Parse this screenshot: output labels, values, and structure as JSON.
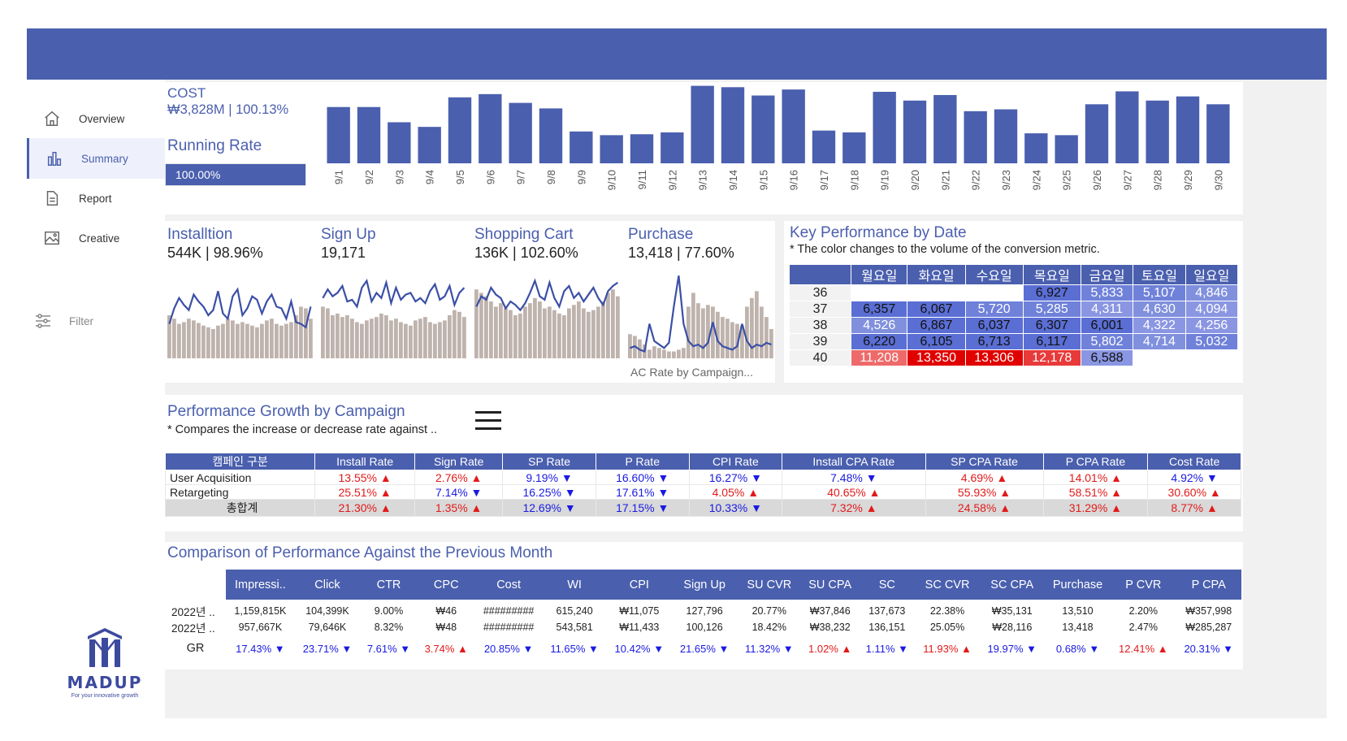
{
  "nav": {
    "items": [
      {
        "label": "Overview",
        "icon": "home-icon"
      },
      {
        "label": "Summary",
        "icon": "bar-chart-icon"
      },
      {
        "label": "Report",
        "icon": "document-icon"
      },
      {
        "label": "Creative",
        "icon": "image-icon"
      }
    ],
    "active": "Summary",
    "filter_label": "Filter"
  },
  "logo": {
    "word": "MADUP",
    "tagline": "For your innovative growth"
  },
  "cost": {
    "title": "COST",
    "value": "₩3,828M | 100.13%",
    "running_rate_label": "Running Rate",
    "running_rate_value": "100.00%",
    "running_rate": 1.0
  },
  "kpis": [
    {
      "title": "Installtion",
      "value": "544K | 98.96%"
    },
    {
      "title": "Sign Up",
      "value": "19,171"
    },
    {
      "title": "Shopping Cart",
      "value": "136K | 102.60%"
    },
    {
      "title": "Purchase",
      "value": "13,418 | 77.60%"
    }
  ],
  "kpi_footer": "AC Rate by Campaign...",
  "key_performance": {
    "title": "Key Performance by Date",
    "subtitle": "* The color changes to the volume of the conversion metric.",
    "days": [
      "월요일",
      "화요일",
      "수요일",
      "목요일",
      "금요일",
      "토요일",
      "일요일"
    ],
    "rows": [
      {
        "week": "36",
        "cells": [
          "",
          "",
          "",
          "6,927",
          "5,833",
          "5,107",
          "4,846"
        ]
      },
      {
        "week": "37",
        "cells": [
          "6,357",
          "6,067",
          "5,720",
          "5,285",
          "4,311",
          "4,630",
          "4,094"
        ]
      },
      {
        "week": "38",
        "cells": [
          "4,526",
          "6,867",
          "6,037",
          "6,307",
          "6,001",
          "4,322",
          "4,256"
        ]
      },
      {
        "week": "39",
        "cells": [
          "6,220",
          "6,105",
          "6,713",
          "6,117",
          "5,802",
          "4,714",
          "5,032"
        ]
      },
      {
        "week": "40",
        "cells": [
          "11,208",
          "13,350",
          "13,306",
          "12,178",
          "6,588",
          "",
          ""
        ]
      }
    ]
  },
  "growth": {
    "title": "Performance Growth by Campaign",
    "subtitle": "* Compares the increase or decrease rate against ..",
    "headers": [
      "캠페인 구분",
      "Install Rate",
      "Sign Rate",
      "SP Rate",
      "P Rate",
      "CPI Rate",
      "Install CPA Rate",
      "SP CPA Rate",
      "P CPA Rate",
      "Cost Rate"
    ],
    "rows": [
      {
        "name": "User Acquisition",
        "cells": [
          [
            "13.55%",
            "up"
          ],
          [
            "2.76%",
            "up"
          ],
          [
            "9.19%",
            "down"
          ],
          [
            "16.60%",
            "down"
          ],
          [
            "16.27%",
            "down"
          ],
          [
            "7.48%",
            "down"
          ],
          [
            "4.69%",
            "up"
          ],
          [
            "14.01%",
            "up"
          ],
          [
            "4.92%",
            "down"
          ]
        ]
      },
      {
        "name": "Retargeting",
        "cells": [
          [
            "25.51%",
            "up"
          ],
          [
            "7.14%",
            "down"
          ],
          [
            "16.25%",
            "down"
          ],
          [
            "17.61%",
            "down"
          ],
          [
            "4.05%",
            "up"
          ],
          [
            "40.65%",
            "up"
          ],
          [
            "55.93%",
            "up"
          ],
          [
            "58.51%",
            "up"
          ],
          [
            "30.60%",
            "up"
          ]
        ]
      },
      {
        "name": "총합계",
        "cells": [
          [
            "21.30%",
            "up"
          ],
          [
            "1.35%",
            "up"
          ],
          [
            "12.69%",
            "down"
          ],
          [
            "17.15%",
            "down"
          ],
          [
            "10.33%",
            "down"
          ],
          [
            "7.32%",
            "up"
          ],
          [
            "24.58%",
            "up"
          ],
          [
            "31.29%",
            "up"
          ],
          [
            "8.77%",
            "up"
          ]
        ]
      }
    ]
  },
  "comparison": {
    "title": "Comparison of Performance Against the Previous Month",
    "headers": [
      "Impressi..",
      "Click",
      "CTR",
      "CPC",
      "Cost",
      "WI",
      "CPI",
      "Sign Up",
      "SU CVR",
      "SU CPA",
      "SC",
      "SC CVR",
      "SC CPA",
      "Purchase",
      "P CVR",
      "P CPA"
    ],
    "rows": [
      {
        "label": "2022년 ..",
        "cells": [
          "1,159,815K",
          "104,399K",
          "9.00%",
          "₩46",
          "#########",
          "615,240",
          "₩11,075",
          "127,796",
          "20.77%",
          "₩37,846",
          "137,673",
          "22.38%",
          "₩35,131",
          "13,510",
          "2.20%",
          "₩357,998"
        ]
      },
      {
        "label": "2022년 ..",
        "cells": [
          "957,667K",
          "79,646K",
          "8.32%",
          "₩48",
          "#########",
          "543,581",
          "₩11,433",
          "100,126",
          "18.42%",
          "₩38,232",
          "136,151",
          "25.05%",
          "₩28,116",
          "13,418",
          "2.47%",
          "₩285,287"
        ]
      }
    ],
    "gr_label": "GR",
    "gr": [
      [
        "17.43%",
        "down"
      ],
      [
        "23.71%",
        "down"
      ],
      [
        "7.61%",
        "down"
      ],
      [
        "3.74%",
        "up"
      ],
      [
        "20.85%",
        "down"
      ],
      [
        "11.65%",
        "down"
      ],
      [
        "10.42%",
        "down"
      ],
      [
        "21.65%",
        "down"
      ],
      [
        "11.32%",
        "down"
      ],
      [
        "1.02%",
        "up"
      ],
      [
        "1.11%",
        "down"
      ],
      [
        "11.93%",
        "up"
      ],
      [
        "19.97%",
        "down"
      ],
      [
        "0.68%",
        "down"
      ],
      [
        "12.41%",
        "up"
      ],
      [
        "20.31%",
        "down"
      ]
    ]
  },
  "colors": {
    "accent": "#4a5fae",
    "bar": "#4a5fae",
    "spark_bar": "#bfb3ad",
    "up": "#e21a1a",
    "down": "#1a1ae2",
    "heat_low": "#5a6ed4",
    "heat_mid": "#8a96e2",
    "heat_high": "#e00000"
  },
  "chart_data": [
    {
      "type": "bar",
      "categories": [
        "9/1",
        "9/2",
        "9/3",
        "9/4",
        "9/5",
        "9/6",
        "9/7",
        "9/8",
        "9/9",
        "9/10",
        "9/11",
        "9/12",
        "9/13",
        "9/14",
        "9/15",
        "9/16",
        "9/17",
        "9/18",
        "9/19",
        "9/20",
        "9/21",
        "9/22",
        "9/23",
        "9/24",
        "9/25",
        "9/26",
        "9/27",
        "9/28",
        "9/29",
        "9/30"
      ],
      "values": [
        122,
        122,
        89,
        79,
        143,
        150,
        131,
        119,
        69,
        61,
        63,
        67,
        168,
        165,
        147,
        160,
        71,
        67,
        155,
        136,
        148,
        113,
        117,
        65,
        61,
        128,
        156,
        136,
        145,
        128
      ],
      "title": "COST",
      "xlabel": "",
      "ylabel": ""
    },
    {
      "type": "bar+line",
      "title": "Installtion",
      "bars": [
        50,
        46,
        40,
        42,
        46,
        44,
        41,
        38,
        36,
        34,
        38,
        40,
        46,
        44,
        40,
        42,
        40,
        38,
        36,
        40,
        44,
        46,
        40,
        38,
        40,
        42,
        50,
        60,
        58,
        46
      ],
      "line": [
        40,
        58,
        70,
        62,
        56,
        74,
        66,
        60,
        50,
        56,
        78,
        52,
        46,
        72,
        80,
        50,
        58,
        72,
        68,
        52,
        66,
        74,
        60,
        58,
        46,
        66,
        42,
        40,
        36,
        60
      ]
    },
    {
      "type": "bar+line",
      "title": "Sign Up",
      "bars": [
        60,
        58,
        50,
        52,
        48,
        50,
        46,
        42,
        40,
        44,
        46,
        48,
        52,
        50,
        44,
        46,
        42,
        40,
        38,
        44,
        46,
        48,
        42,
        40,
        42,
        44,
        50,
        56,
        54,
        48
      ],
      "line": [
        70,
        80,
        72,
        76,
        84,
        66,
        68,
        60,
        82,
        90,
        66,
        76,
        70,
        88,
        64,
        82,
        68,
        74,
        76,
        66,
        70,
        64,
        78,
        86,
        68,
        72,
        84,
        62,
        76,
        82
      ]
    },
    {
      "type": "bar+line",
      "title": "Shopping Cart",
      "bars": [
        80,
        76,
        72,
        66,
        60,
        64,
        58,
        56,
        50,
        52,
        60,
        64,
        70,
        66,
        58,
        60,
        56,
        52,
        50,
        58,
        62,
        66,
        58,
        54,
        56,
        60,
        66,
        76,
        80,
        72
      ],
      "line": [
        60,
        72,
        68,
        82,
        74,
        70,
        58,
        66,
        62,
        56,
        64,
        76,
        90,
        72,
        68,
        88,
        70,
        60,
        78,
        84,
        70,
        76,
        66,
        74,
        82,
        70,
        62,
        78,
        84,
        88
      ]
    },
    {
      "type": "bar+line",
      "title": "Purchase",
      "bars": [
        28,
        26,
        22,
        16,
        10,
        14,
        12,
        10,
        8,
        8,
        10,
        12,
        60,
        76,
        64,
        58,
        62,
        60,
        54,
        48,
        46,
        42,
        40,
        38,
        60,
        70,
        78,
        60,
        48,
        34
      ],
      "line": [
        12,
        14,
        10,
        8,
        40,
        20,
        16,
        12,
        18,
        60,
        96,
        40,
        20,
        14,
        16,
        12,
        18,
        42,
        20,
        14,
        12,
        10,
        14,
        40,
        20,
        12,
        16,
        14,
        18,
        16
      ]
    }
  ]
}
